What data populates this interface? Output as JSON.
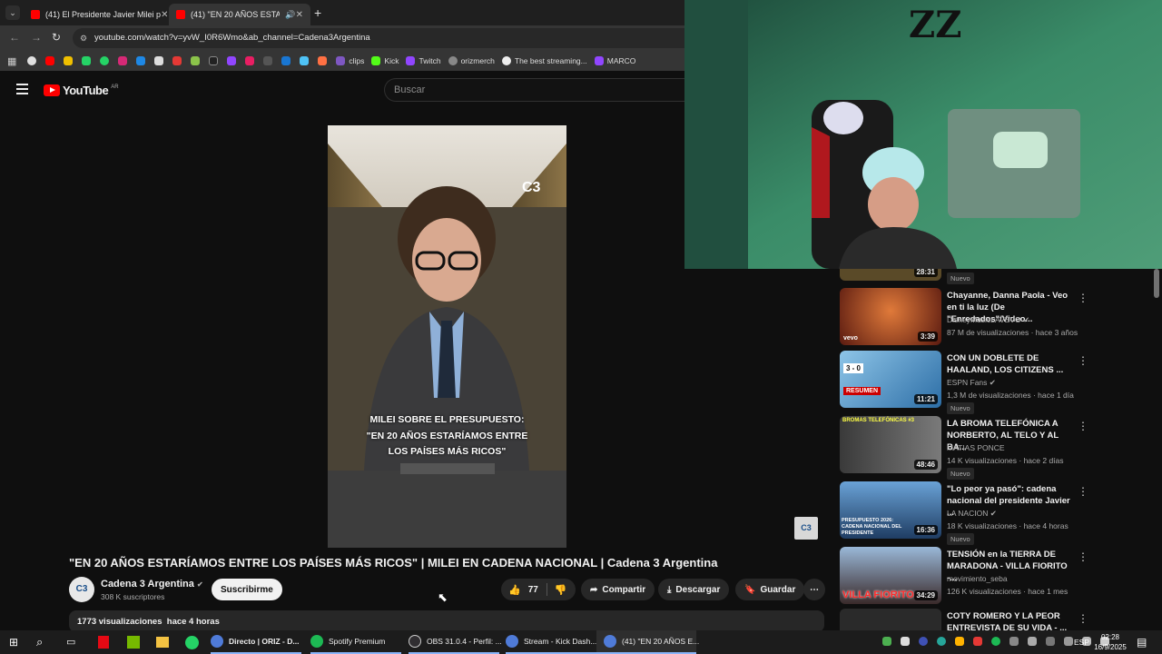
{
  "browser": {
    "tabs": [
      {
        "title": "(41) El Presidente Javier Milei p",
        "active": false
      },
      {
        "title": "(41) \"EN 20 AÑOS ESTARÍA",
        "active": true
      }
    ],
    "url": "youtube.com/watch?v=yvW_I0R6Wmo&ab_channel=Cadena3Argentina",
    "bookmarks": [
      "clips",
      "Kick",
      "Twitch",
      "orizmerch",
      "The best streaming...",
      "MARCO"
    ]
  },
  "youtube": {
    "logo_text": "YouTube",
    "region": "AR",
    "search_placeholder": "Buscar",
    "video": {
      "overlay_caption_line1": "MILEI SOBRE EL PRESUPUESTO:",
      "overlay_caption_line2": "\"EN 20 AÑOS ESTARÍAMOS ENTRE",
      "overlay_caption_line3": "LOS PAÍSES MÁS RICOS\"",
      "watermark": "C3",
      "title": "\"EN 20 AÑOS ESTARÍAMOS ENTRE LOS PAÍSES MÁS RICOS\" | MILEI EN CADENA NACIONAL | Cadena 3 Argentina",
      "channel": "Cadena 3 Argentina",
      "channel_avatar": "C3",
      "subscribers": "308 K suscriptores",
      "subscribe_label": "Suscribirme",
      "likes": "77",
      "share_label": "Compartir",
      "download_label": "Descargar",
      "save_label": "Guardar",
      "views": "1773 visualizaciones",
      "time": "hace 4 horas",
      "corner_logo": "C3"
    },
    "sidebar": [
      {
        "duration": "28:31",
        "badge": "Nuevo"
      },
      {
        "title": "Chayanne, Danna Paola - Veo en ti la luz (De \"Enredados\"/Video...",
        "channel": "DisneyMusicLAVEVO",
        "meta": "87 M de visualizaciones · hace 3 años",
        "duration": "3:39",
        "thumb_text": "vevo"
      },
      {
        "title": "CON UN DOBLETE DE HAALAND, LOS CITIZENS ...",
        "channel": "ESPN Fans",
        "meta": "1,3 M de visualizaciones · hace 1 día",
        "duration": "11:21",
        "badge": "Nuevo",
        "thumb_text": "3 - 0",
        "thumb_text2": "RESUMEN"
      },
      {
        "title": "LA BROMA TELEFÓNICA A NORBERTO, AL TELO Y AL BA...",
        "channel": "MATIAS PONCE",
        "meta": "14 K visualizaciones · hace 2 días",
        "duration": "48:46",
        "badge": "Nuevo",
        "thumb_text": "BROMAS TELEFÓNICAS #3"
      },
      {
        "title": "\"Lo peor ya pasó\": cadena nacional del presidente Javier ...",
        "channel": "LA NACION",
        "meta": "18 K visualizaciones · hace 4 horas",
        "duration": "16:36",
        "badge": "Nuevo",
        "thumb_text": "PRESUPUESTO 2026: CADENA NACIONAL DEL PRESIDENTE"
      },
      {
        "title": "TENSIÓN en la TIERRA DE MARADONA - VILLA FIORITO -...",
        "channel": "movimiento_seba",
        "meta": "126 K visualizaciones · hace 1 mes",
        "duration": "34:29",
        "thumb_text": "VILLA FIORITO"
      },
      {
        "title": "COTY ROMERO Y LA PEOR ENTREVISTA DE SU VIDA - ..."
      }
    ]
  },
  "taskbar": {
    "items": [
      "Directo | ORIZ - D...",
      "Spotify Premium",
      "OBS 31.0.4 - Perfil: ...",
      "Stream - Kick Dash...",
      "(41) \"EN 20 AÑOS E..."
    ],
    "language": "ESP",
    "time": "02:28",
    "date": "16/9/2025"
  },
  "colors": {
    "youtube_red": "#ff0000",
    "background": "#0f0f0f",
    "webcam_green": "#2f7a5c"
  }
}
